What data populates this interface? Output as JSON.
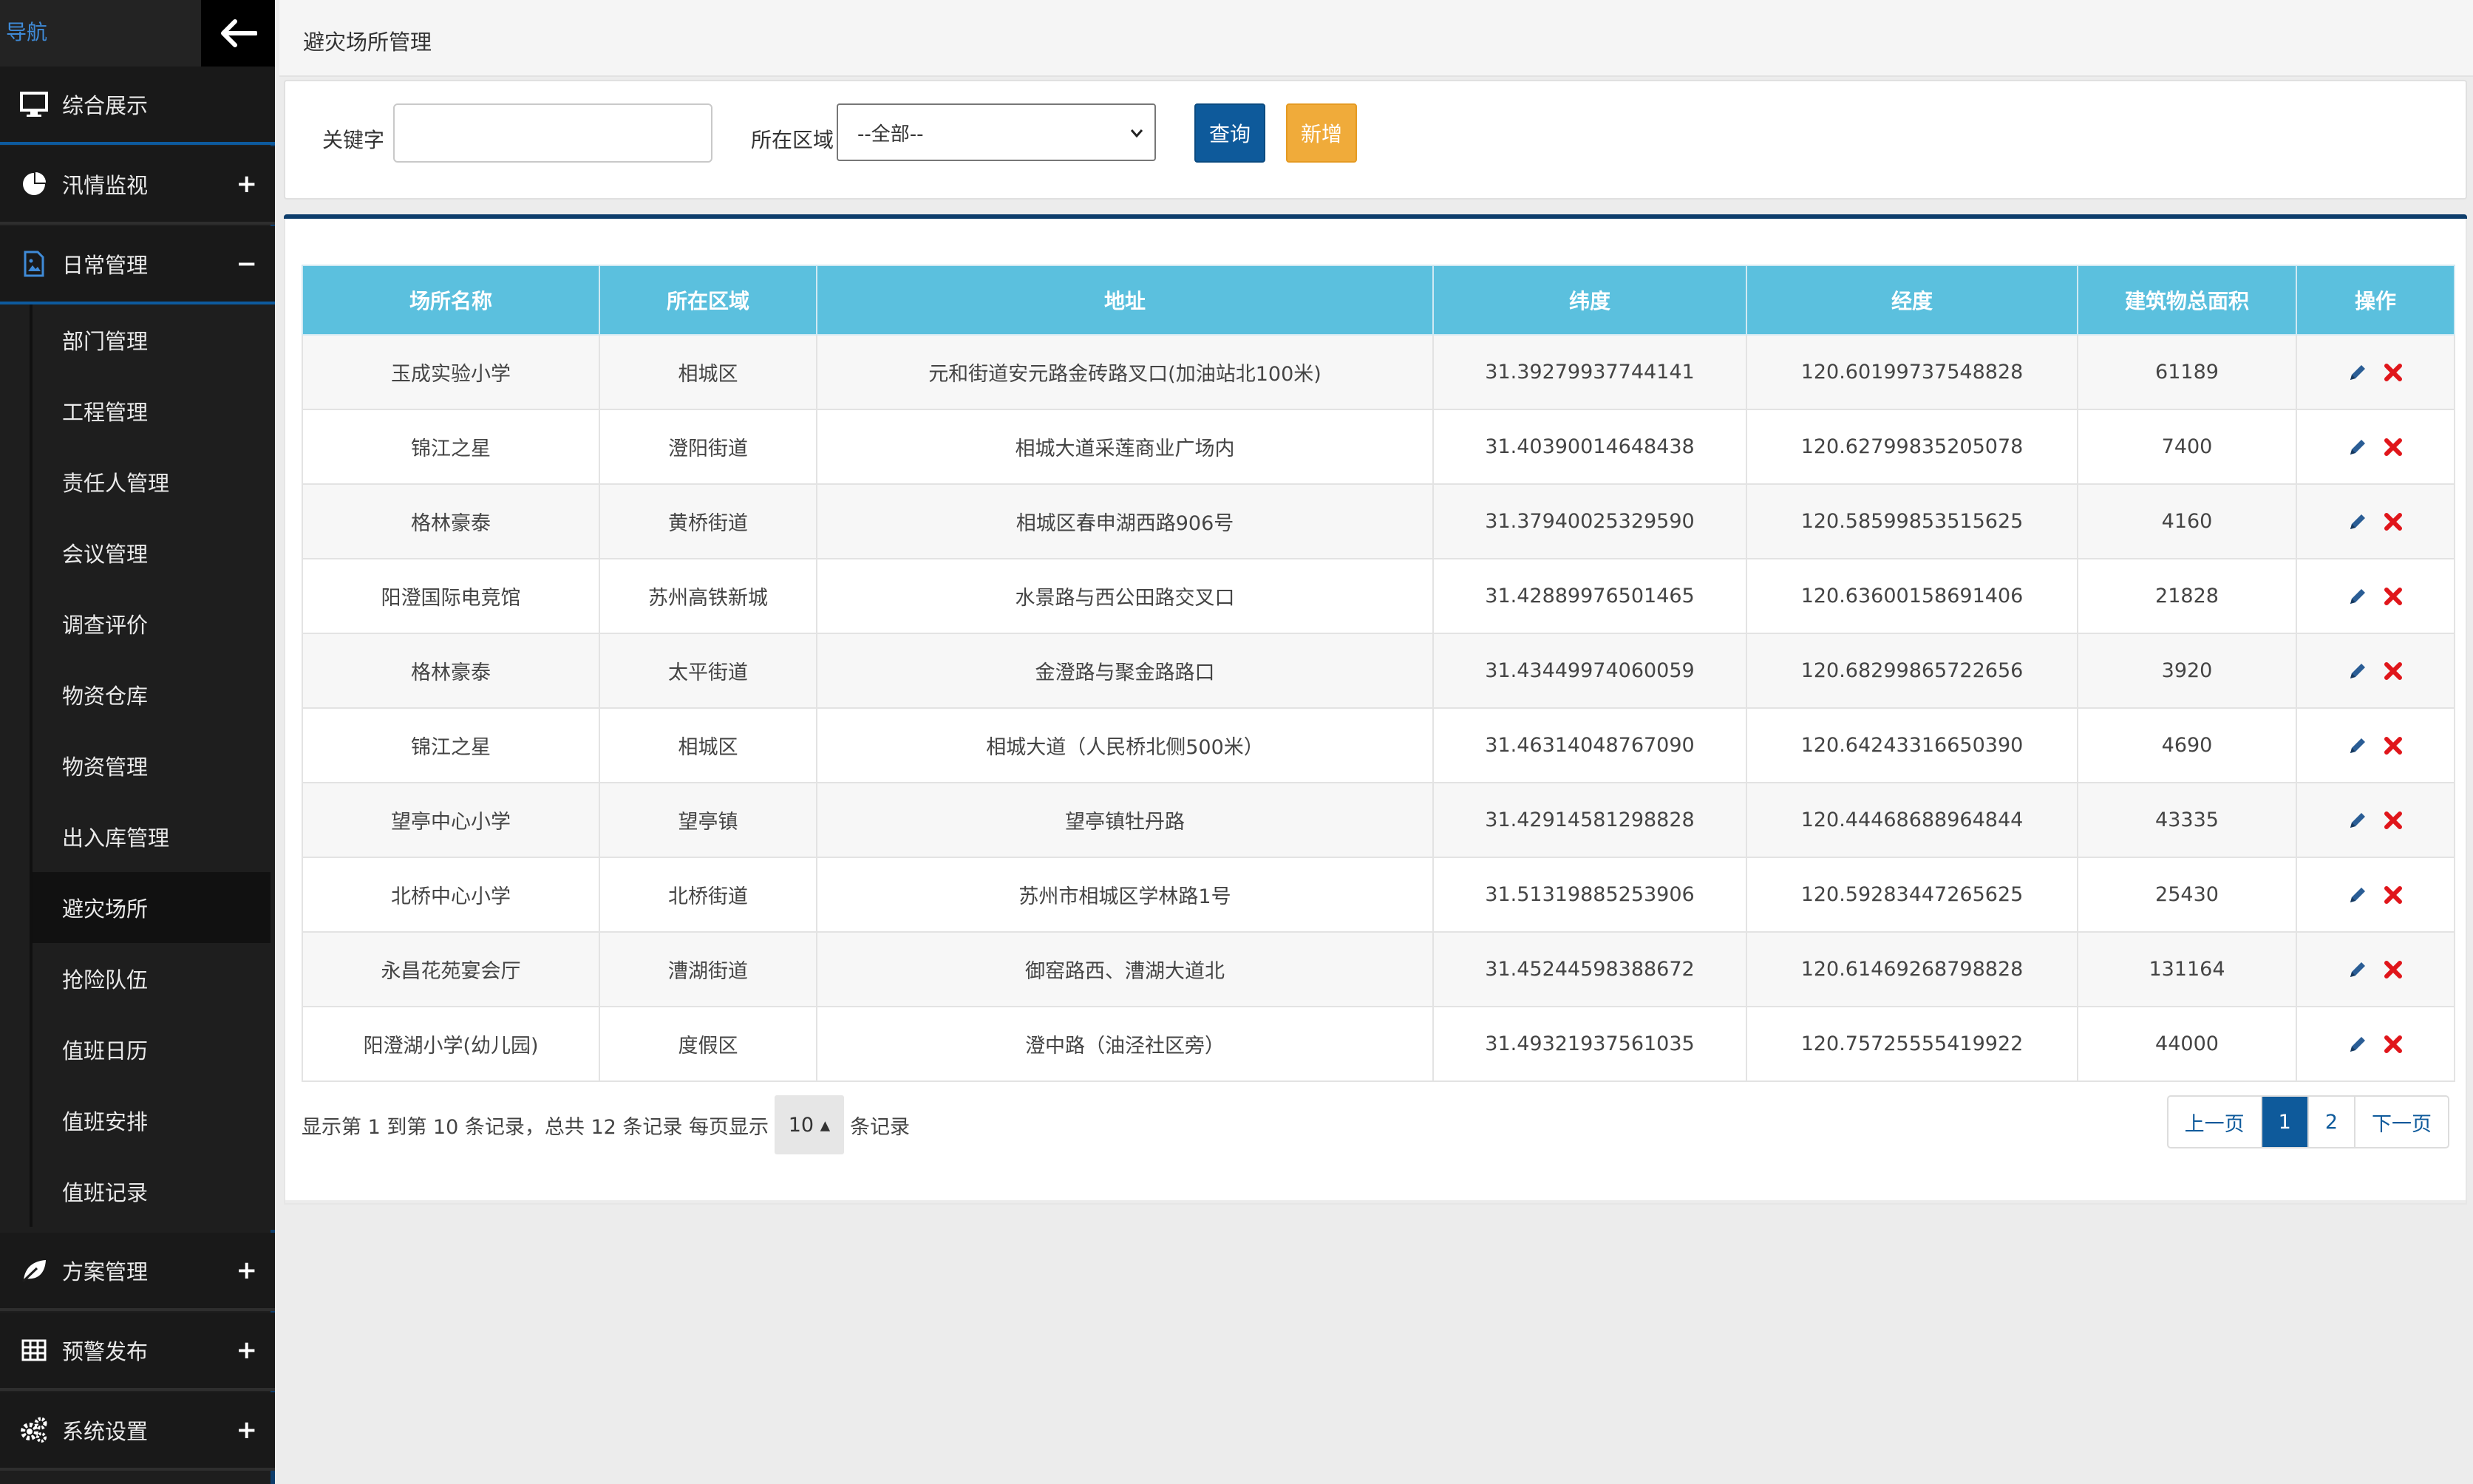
{
  "sidebar": {
    "nav_title": "导航",
    "menus": [
      {
        "label": "综合展示",
        "toggle": ""
      },
      {
        "label": "汛情监视",
        "toggle": "+"
      },
      {
        "label": "日常管理",
        "toggle": "−"
      },
      {
        "label": "方案管理",
        "toggle": "+"
      },
      {
        "label": "预警发布",
        "toggle": "+"
      },
      {
        "label": "系统设置",
        "toggle": "+"
      }
    ],
    "sub_items": [
      "部门管理",
      "工程管理",
      "责任人管理",
      "会议管理",
      "调查评价",
      "物资仓库",
      "物资管理",
      "出入库管理",
      "避灾场所",
      "抢险队伍",
      "值班日历",
      "值班安排",
      "值班记录"
    ]
  },
  "header": {
    "title": "避灾场所管理"
  },
  "filter": {
    "keyword_label": "关键字",
    "keyword_value": "",
    "region_label": "所在区域",
    "region_selected": "--全部--",
    "query_label": "查询",
    "add_label": "新增"
  },
  "table": {
    "headers": [
      "场所名称",
      "所在区域",
      "地址",
      "纬度",
      "经度",
      "建筑物总面积",
      "操作"
    ],
    "rows": [
      [
        "玉成实验小学",
        "相城区",
        "元和街道安元路金砖路叉口(加油站北100米)",
        "31.39279937744141",
        "120.60199737548828",
        "61189"
      ],
      [
        "锦江之星",
        "澄阳街道",
        "相城大道采莲商业广场内",
        "31.40390014648438",
        "120.62799835205078",
        "7400"
      ],
      [
        "格林豪泰",
        "黄桥街道",
        "相城区春申湖西路906号",
        "31.37940025329590",
        "120.58599853515625",
        "4160"
      ],
      [
        "阳澄国际电竞馆",
        "苏州高铁新城",
        "水景路与西公田路交叉口",
        "31.42889976501465",
        "120.63600158691406",
        "21828"
      ],
      [
        "格林豪泰",
        "太平街道",
        "金澄路与聚金路路口",
        "31.43449974060059",
        "120.68299865722656",
        "3920"
      ],
      [
        "锦江之星",
        "相城区",
        "相城大道（人民桥北侧500米）",
        "31.46314048767090",
        "120.64243316650390",
        "4690"
      ],
      [
        "望亭中心小学",
        "望亭镇",
        "望亭镇牡丹路",
        "31.42914581298828",
        "120.44468688964844",
        "43335"
      ],
      [
        "北桥中心小学",
        "北桥街道",
        "苏州市相城区学林路1号",
        "31.51319885253906",
        "120.59283447265625",
        "25430"
      ],
      [
        "永昌花苑宴会厅",
        "漕湖街道",
        "御窑路西、漕湖大道北",
        "31.45244598388672",
        "120.61469268798828",
        "131164"
      ],
      [
        "阳澄湖小学(幼儿园)",
        "度假区",
        "澄中路（油泾社区旁）",
        "31.49321937561035",
        "120.75725555419922",
        "44000"
      ]
    ]
  },
  "pagination": {
    "info_prefix": "显示第 1 到第 10 条记录，总共 12 条记录 每页显示",
    "page_size": "10 ▴",
    "info_suffix": "条记录",
    "prev": "上一页",
    "pages": [
      "1",
      "2"
    ],
    "next": "下一页"
  },
  "colors": {
    "sidebar_bg": "#1e1e1e",
    "accent_blue": "#0e5a9b",
    "header_cyan": "#5bc0de",
    "add_orange": "#f0ab3a",
    "delete_red": "#e0161b"
  }
}
